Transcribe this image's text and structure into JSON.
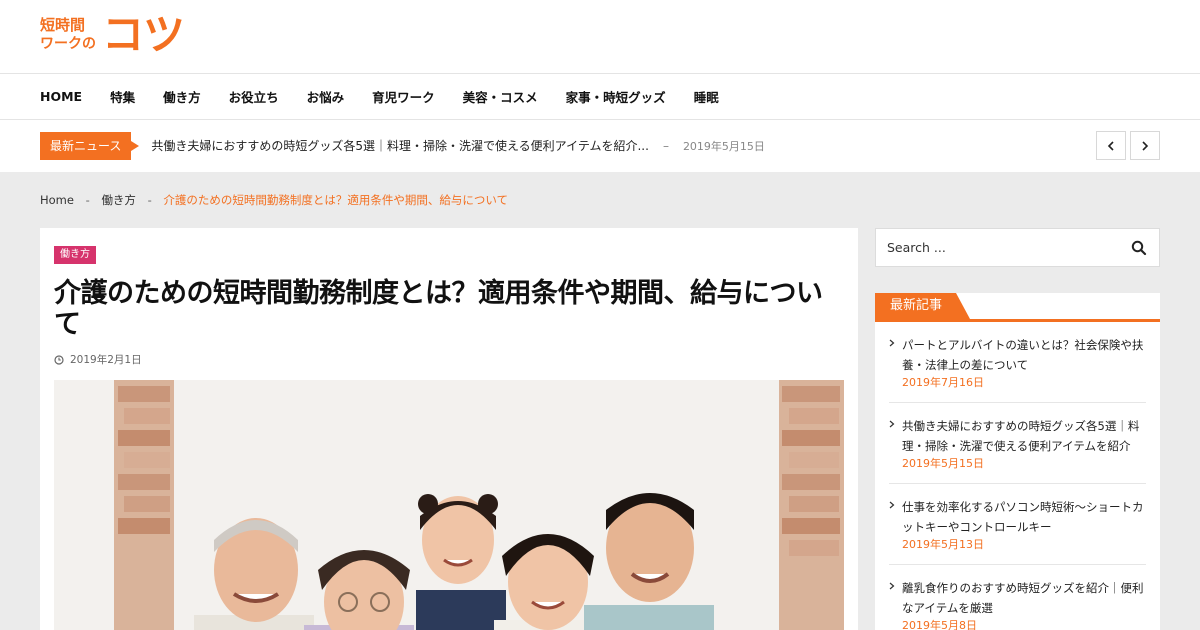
{
  "logo": {
    "small_line1": "短時間",
    "small_line2": "ワークの",
    "big": "コツ"
  },
  "nav": {
    "items": [
      {
        "label": "HOME"
      },
      {
        "label": "特集"
      },
      {
        "label": "働き方"
      },
      {
        "label": "お役立ち"
      },
      {
        "label": "お悩み"
      },
      {
        "label": "育児ワーク"
      },
      {
        "label": "美容・コスメ"
      },
      {
        "label": "家事・時短グッズ"
      },
      {
        "label": "睡眠"
      }
    ]
  },
  "ticker": {
    "label": "最新ニュース",
    "headline": "共働き夫婦におすすめの時短グッズ各5選｜料理・掃除・洗濯で使える便利アイテムを紹介...",
    "separator": "–",
    "date": "2019年5月15日",
    "prev_icon": "chevron-left-icon",
    "next_icon": "chevron-right-icon"
  },
  "breadcrumb": {
    "home": "Home",
    "separator": "-",
    "category": "働き方",
    "current": "介護のための短時間勤務制度とは？適用条件や期間、給与について"
  },
  "article": {
    "category": "働き方",
    "title": "介護のための短時間勤務制度とは？適用条件や期間、給与について",
    "date": "2019年2月1日",
    "date_icon": "clock-icon"
  },
  "search": {
    "placeholder": "Search ...",
    "icon": "search-icon"
  },
  "recent": {
    "title": "最新記事",
    "posts": [
      {
        "title": "パートとアルバイトの違いとは？社会保険や扶養・法律上の差について",
        "date": "2019年7月16日"
      },
      {
        "title": "共働き夫婦におすすめの時短グッズ各5選｜料理・掃除・洗濯で使える便利アイテムを紹介",
        "date": "2019年5月15日"
      },
      {
        "title": "仕事を効率化するパソコン時短術～ショートカットキーやコントロールキー",
        "date": "2019年5月13日"
      },
      {
        "title": "離乳食作りのおすすめ時短グッズを紹介｜便利なアイテムを厳選",
        "date": "2019年5月8日"
      }
    ]
  },
  "colors": {
    "accent": "#f37021",
    "category_badge": "#d6336c",
    "content_bg": "#ebebeb"
  }
}
